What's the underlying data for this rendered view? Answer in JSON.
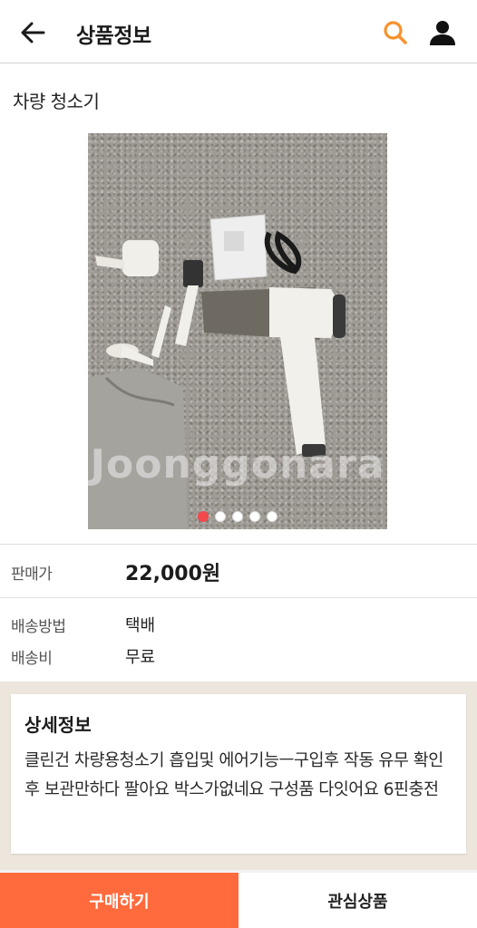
{
  "header": {
    "title": "상품정보",
    "back_icon": "arrow-left-icon",
    "search_icon": "search-icon",
    "user_icon": "user-icon",
    "accent_color": "#f7922d"
  },
  "product": {
    "name": "차량 청소기",
    "watermark": "Joonggonara",
    "image_count": 5,
    "active_image": 1
  },
  "info": {
    "price_label": "판매가",
    "price_value": "22,000원",
    "shipping_method_label": "배송방법",
    "shipping_method_value": "택배",
    "shipping_fee_label": "배송비",
    "shipping_fee_value": "무료"
  },
  "detail": {
    "title": "상세정보",
    "body": "클린건 차량용청소기 흡입및 에어기능ㅡ구입후 작동 유무 확인후 보관만하다 팔아요 박스가없네요 구성품 다잇어요 6핀충전"
  },
  "bottom": {
    "buy_label": "구매하기",
    "wish_label": "관심상품",
    "buy_color": "#ff6b3d"
  }
}
